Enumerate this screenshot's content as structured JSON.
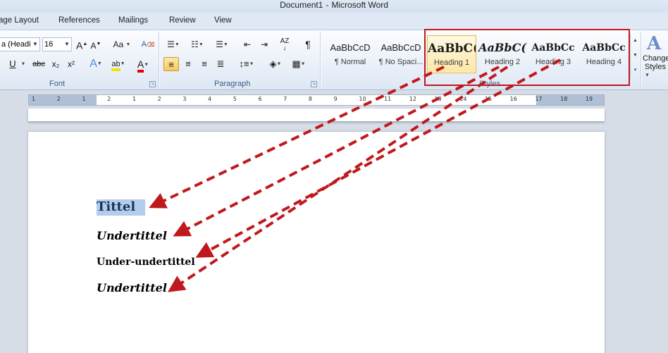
{
  "window": {
    "doc_name": "Document1",
    "separator": "-",
    "app_name": "Microsoft Word"
  },
  "tabs": [
    "age Layout",
    "References",
    "Mailings",
    "Review",
    "View"
  ],
  "ribbon": {
    "font": {
      "font_name": "a (Headi",
      "font_size": "16",
      "group_label": "Font",
      "grow_glyph": "A",
      "shrink_glyph": "A",
      "change_case_glyph": "Aa",
      "clear_format_glyph": "A",
      "underline_glyph": "U",
      "strike_glyph": "abc",
      "subscript_glyph": "x₂",
      "superscript_glyph": "x²",
      "text_effects_glyph": "A",
      "highlight_glyph": "ab",
      "font_color_glyph": "A",
      "highlight_color": "#f5e400",
      "font_color": "#e00000"
    },
    "paragraph": {
      "group_label": "Paragraph",
      "pilcrow": "¶",
      "sort_glyph": "AZ"
    },
    "styles": {
      "group_label": "Styles",
      "items": [
        {
          "sample": "AaBbCcD",
          "name": "¶ Normal"
        },
        {
          "sample": "AaBbCcD",
          "name": "¶ No Spaci..."
        },
        {
          "sample": "AaBbC(",
          "name": "Heading 1"
        },
        {
          "sample": "AaBbC(",
          "name": "Heading 2"
        },
        {
          "sample": "AaBbCc",
          "name": "Heading 3"
        },
        {
          "sample": "AaBbCc",
          "name": "Heading 4"
        }
      ],
      "change_styles": {
        "glyph": "A",
        "line1": "Change",
        "line2": "Styles"
      }
    }
  },
  "ruler": {
    "ticks": [
      "1",
      "2",
      "1",
      "2",
      "1",
      "2",
      "3",
      "4",
      "5",
      "6",
      "7",
      "8",
      "9",
      "10",
      "11",
      "12",
      "13",
      "14",
      "15",
      "16",
      "17",
      "18",
      "19"
    ]
  },
  "document": {
    "lines": [
      "Tittel",
      "Undertittel",
      "Under-undertittel",
      "Undertittel"
    ]
  },
  "colors": {
    "annotation": "#c0191d",
    "selection": "#b4cdea"
  }
}
